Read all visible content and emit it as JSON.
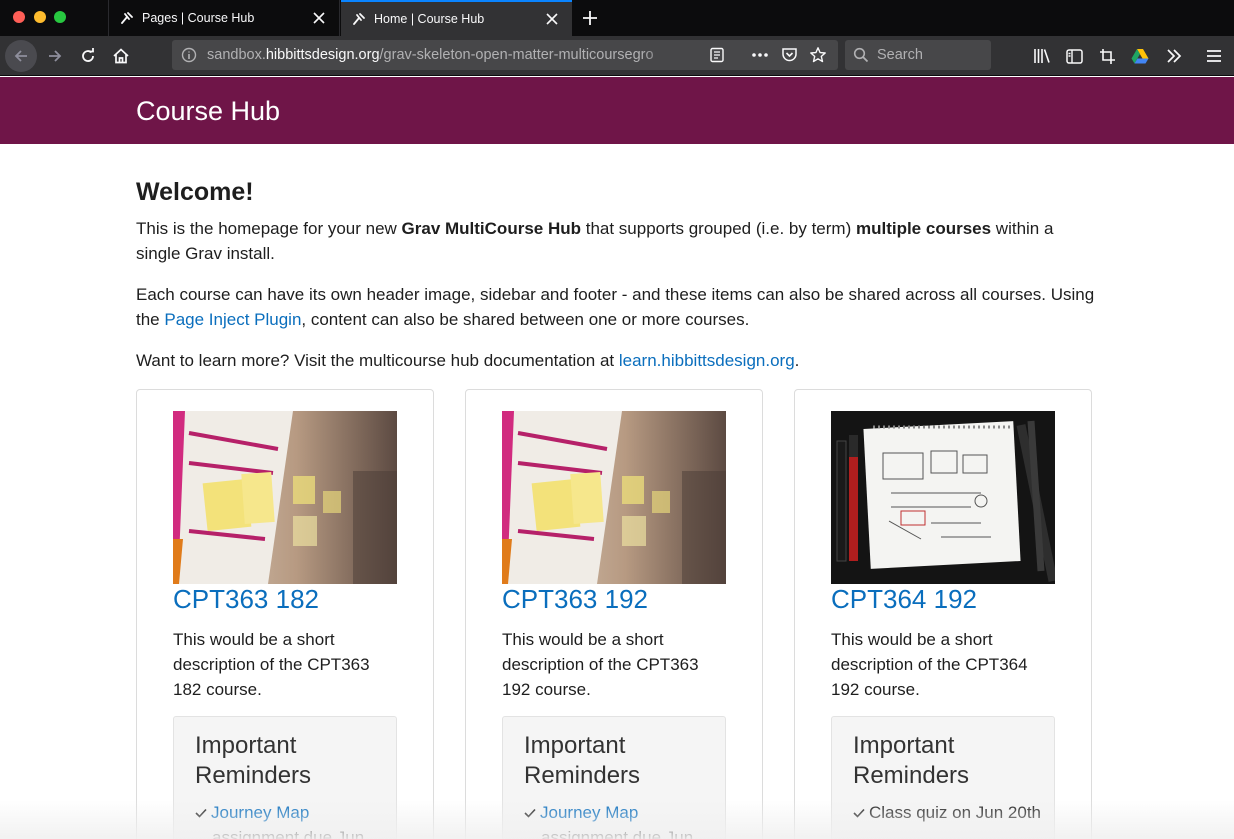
{
  "browser": {
    "tabs": [
      {
        "title": "Pages | Course Hub",
        "active": false
      },
      {
        "title": "Home | Course Hub",
        "active": true
      }
    ],
    "url": {
      "prefix": "sandbox.",
      "host": "hibbittsdesign.org",
      "path": "/grav-skeleton-open-matter-multicoursegro"
    },
    "search_placeholder": "Search",
    "icons": [
      "back-icon",
      "forward-icon",
      "reload-icon",
      "home-icon",
      "info-icon",
      "reader-view-icon",
      "more-icon",
      "pocket-icon",
      "star-icon",
      "search-icon",
      "library-icon",
      "sidebar-icon",
      "screenshot-icon",
      "google-drive-icon",
      "overflow-icon",
      "menu-icon"
    ],
    "accent_color": "#0a84ff"
  },
  "site": {
    "title": "Course Hub",
    "header_color": "#6f1548"
  },
  "main": {
    "heading": "Welcome!",
    "intro": {
      "t1": "This is the homepage for your new ",
      "b1": "Grav MultiCourse Hub",
      "t2": " that supports grouped (i.e. by term) ",
      "b2": "multiple courses",
      "t3": " within a single Grav install."
    },
    "para2": {
      "t1": "Each course can have its own header image, sidebar and footer - and these items can also be shared across all courses. Using the ",
      "link": "Page Inject Plugin",
      "t2": ", content can also be shared between one or more courses."
    },
    "para3": {
      "t1": "Want to learn more? Visit the multicourse hub documentation at ",
      "link": "learn.hibbittsdesign.org",
      "t2": "."
    },
    "link_color": "#0a6ebd"
  },
  "courses": [
    {
      "title": "CPT363 182",
      "description": "This would be a short description of the CPT363 182 course.",
      "reminders_title": "Important Reminders",
      "reminder_link": "Journey Map",
      "reminder_text": "assignment due Jun"
    },
    {
      "title": "CPT363 192",
      "description": "This would be a short description of the CPT363 192 course.",
      "reminders_title": "Important Reminders",
      "reminder_link": "Journey Map",
      "reminder_text": "assignment due Jun"
    },
    {
      "title": "CPT364 192",
      "description": "This would be a short description of the CPT364 192 course.",
      "reminders_title": "Important Reminders",
      "reminder_link": "",
      "reminder_text": "Class quiz on Jun 20th"
    }
  ]
}
